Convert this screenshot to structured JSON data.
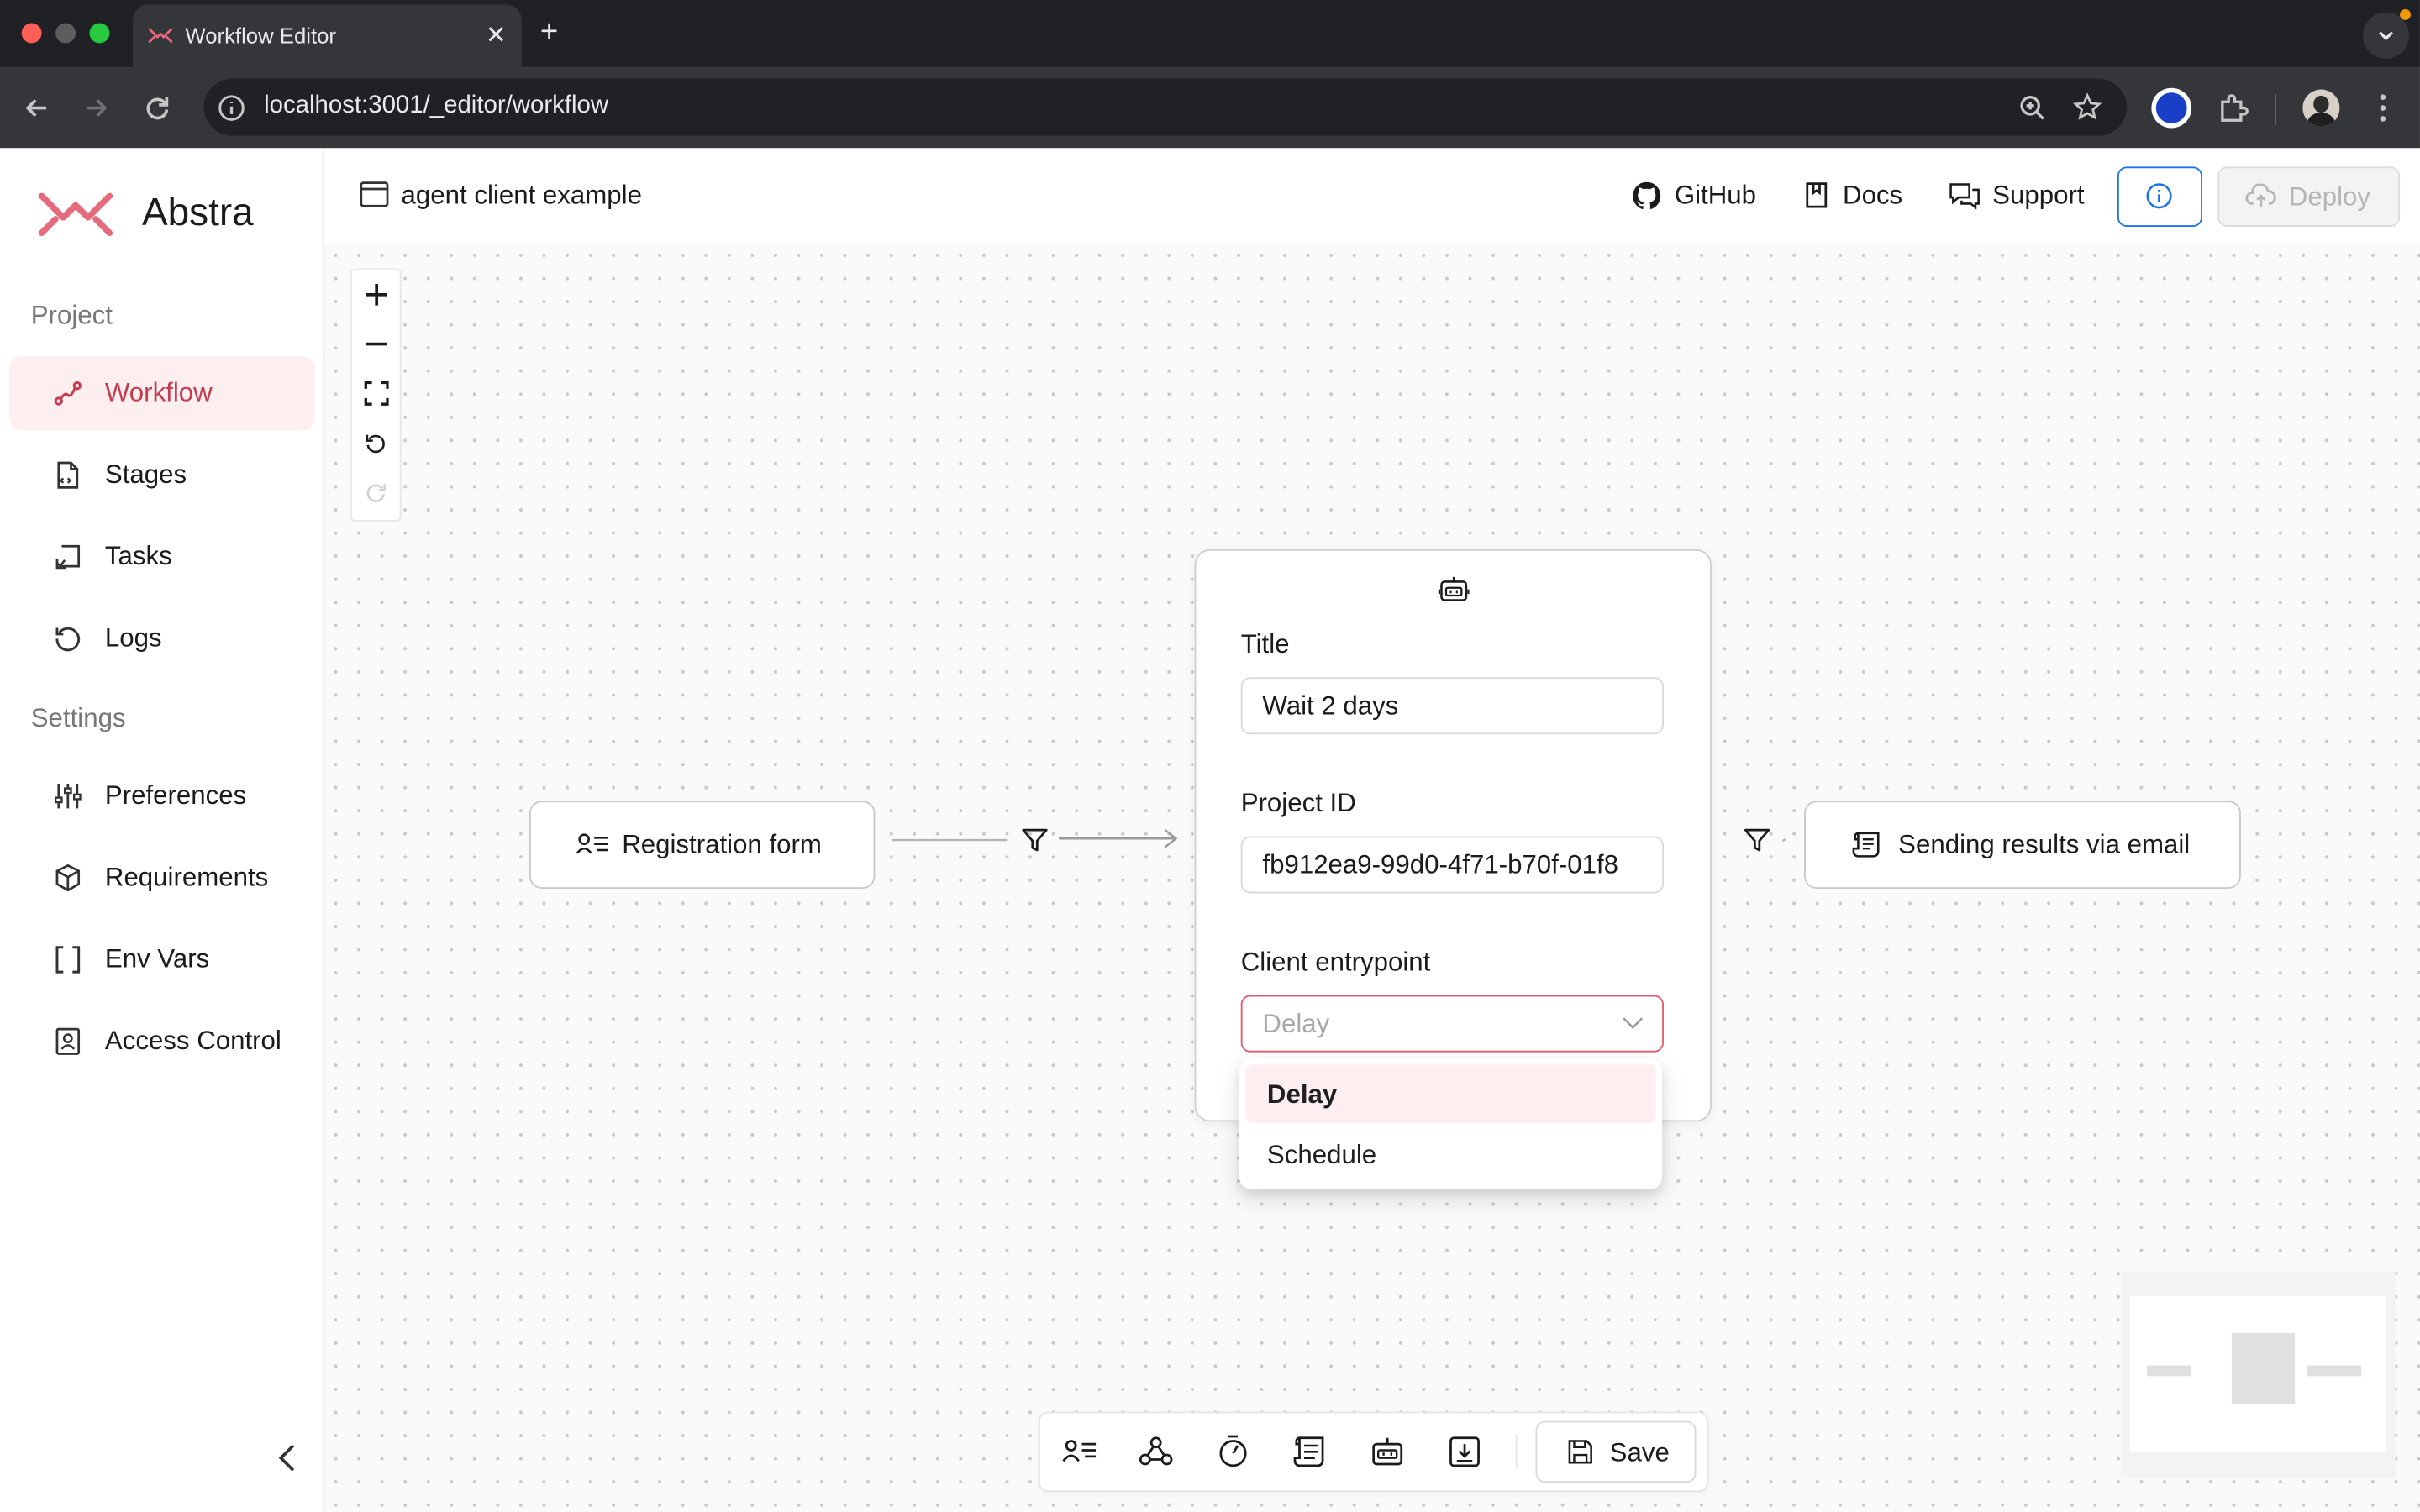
{
  "browser": {
    "tab_title": "Workflow Editor",
    "url": "localhost:3001/_editor/workflow"
  },
  "sidebar": {
    "logo_text": "Abstra",
    "sections": {
      "project": "Project",
      "settings": "Settings"
    },
    "items": [
      {
        "label": "Workflow",
        "icon": "workflow-icon",
        "active": true
      },
      {
        "label": "Stages",
        "icon": "file-code-icon"
      },
      {
        "label": "Tasks",
        "icon": "tasks-icon"
      },
      {
        "label": "Logs",
        "icon": "history-icon"
      },
      {
        "label": "Preferences",
        "icon": "sliders-icon"
      },
      {
        "label": "Requirements",
        "icon": "package-icon"
      },
      {
        "label": "Env Vars",
        "icon": "brackets-icon"
      },
      {
        "label": "Access Control",
        "icon": "badge-icon"
      }
    ]
  },
  "header": {
    "project_name": "agent client example",
    "links": {
      "github": "GitHub",
      "docs": "Docs",
      "support": "Support"
    },
    "deploy_label": "Deploy"
  },
  "canvas": {
    "nodes": {
      "left": "Registration form",
      "right": "Sending results via email"
    },
    "panel": {
      "title_label": "Title",
      "title_value": "Wait 2 days",
      "project_id_label": "Project ID",
      "project_id_value": "fb912ea9-99d0-4f71-b70f-01f8",
      "entrypoint_label": "Client entrypoint",
      "entrypoint_placeholder": "Delay",
      "options": [
        "Delay",
        "Schedule"
      ]
    },
    "toolbar": {
      "save_label": "Save"
    }
  },
  "colors": {
    "accent": "#d9485f",
    "active_bg": "#fdeff0",
    "info_blue": "#1a73e8"
  }
}
